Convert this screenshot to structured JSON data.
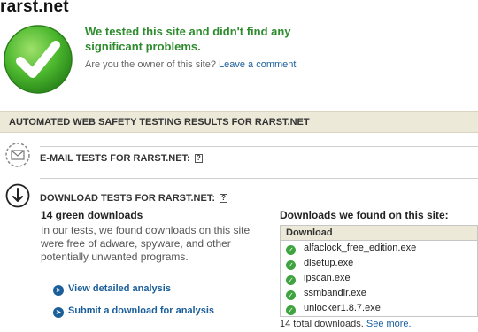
{
  "site": {
    "title": "rarst.net"
  },
  "verdict": {
    "message": "We tested this site and didn't find any significant problems.",
    "owner_prompt": "Are you the owner of this site?",
    "owner_link": "Leave a comment"
  },
  "section": {
    "title": "AUTOMATED WEB SAFETY TESTING RESULTS FOR RARST.NET"
  },
  "email_tests": {
    "title": "E-MAIL TESTS FOR RARST.NET:",
    "help": "?"
  },
  "download_tests": {
    "title": "DOWNLOAD TESTS FOR RARST.NET:",
    "help": "?",
    "green_count": "14 green downloads",
    "description": "In our tests, we found downloads on this site were free of adware, spyware, and other potentially unwanted programs.",
    "actions": [
      {
        "label": "View detailed analysis"
      },
      {
        "label": "Submit a download for analysis"
      }
    ],
    "found_title": "Downloads we found on this site:",
    "table_header": "Download",
    "files": [
      "alfaclock_free_edition.exe",
      "dlsetup.exe",
      "ipscan.exe",
      "ssmbandlr.exe",
      "unlocker1.8.7.exe"
    ],
    "total_text": "14 total downloads.",
    "see_more": "See more."
  },
  "colors": {
    "accent_green": "#2e8b2e",
    "link_blue": "#1a5e9a",
    "section_bg": "#ece9d8"
  },
  "icons": {
    "badge": "check-icon",
    "email": "envelope-icon",
    "download": "download-arrow-icon",
    "row_status": "check-icon",
    "action": "arrow-right-icon"
  }
}
